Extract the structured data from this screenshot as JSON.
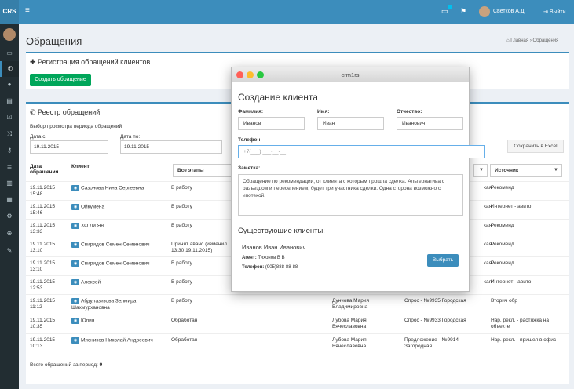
{
  "topbar": {
    "logo": "CRS",
    "menu_icon": "hamburger-icon",
    "user_name": "Светков А.Д.",
    "logout_label": "Выйти",
    "accent": "#3c8dbc"
  },
  "sidebar": {
    "icons": [
      "desktop-icon",
      "phone-icon",
      "user-icon",
      "document-icon",
      "check-icon",
      "shuffle-icon",
      "key-icon",
      "database-icon",
      "chart-icon",
      "calendar-icon",
      "tools-icon",
      "globe-icon",
      "edit-icon"
    ]
  },
  "page": {
    "title": "Обращения",
    "breadcrumb_home": "Главная",
    "breadcrumb_current": "Обращения"
  },
  "registration": {
    "title": "Регистрация обращений клиентов",
    "create_button": "Создать обращение"
  },
  "registry": {
    "title": "Реестр обращений",
    "period_label": "Выбор просмотра периода обращений",
    "date_from_label": "Дата с:",
    "date_from_value": "19.11.2015",
    "date_to_label": "Дата по:",
    "date_to_value": "19.11.2015",
    "export_button": "Сохранить в Excel",
    "columns": {
      "date": "Дата обращения",
      "client": "Клиент",
      "stages_select": "Все этапы",
      "source_select": "Источник"
    },
    "rows": [
      {
        "date": "19.11.2015",
        "time": "15:48",
        "client": "Сазонова Нина Сергеевна",
        "stage": "В работу",
        "agent": "",
        "offer": "кая",
        "source": "Рекоменд"
      },
      {
        "date": "19.11.2015",
        "time": "15:46",
        "client": "Ойкумена",
        "stage": "В работу",
        "agent": "",
        "offer": "кая",
        "source": "Интернет - авито"
      },
      {
        "date": "19.11.2015",
        "time": "13:33",
        "client": "ХО Ли Ян",
        "stage": "В работу",
        "agent": "",
        "offer": "кая",
        "source": "Рекоменд"
      },
      {
        "date": "19.11.2015",
        "time": "13:10",
        "client": "Свиридов Семен Семенович",
        "stage": "Принят аванс (изменил 13:30 19.11.2015)",
        "agent": "",
        "offer": "кая",
        "source": "Рекоменд"
      },
      {
        "date": "19.11.2015",
        "time": "13:10",
        "client": "Свиридов Семен Семенович",
        "stage": "В работу",
        "agent": "",
        "offer": "кая",
        "source": "Рекоменд"
      },
      {
        "date": "19.11.2015",
        "time": "12:53",
        "client": "Алексей",
        "stage": "В работу",
        "agent": "",
        "offer": "кая",
        "source": "Интернет - авито"
      },
      {
        "date": "19.11.2015",
        "time": "11:12",
        "client": "Абдулазизова Зелмира Шахмурхановна",
        "stage": "В работу",
        "agent": "Дунчова Мария Владимировна",
        "offer": "Спрос - №9935 Городская",
        "source": "Вторич обр"
      },
      {
        "date": "19.11.2015",
        "time": "10:35",
        "client": "Юлия",
        "stage": "Обработан",
        "agent": "Лубова Мария Вячеславовна",
        "offer": "Спрос - №9933 Городская",
        "source": "Нар. рекл. - растяжка на объекте"
      },
      {
        "date": "19.11.2015",
        "time": "10:13",
        "client": "Мясников Николай Андреевич",
        "stage": "Обработан",
        "agent": "Лубова Мария Вячеславовна",
        "offer": "Предложение - №9914 Загородная",
        "source": "Нар. рекл. - пришел в офис"
      }
    ],
    "total_label": "Всего обращений за период:",
    "total_value": "9"
  },
  "modal": {
    "window_title": "crm1rs",
    "heading": "Создание клиента",
    "surname_label": "Фамилия:",
    "surname_value": "Иванов",
    "name_label": "Имя:",
    "name_value": "Иван",
    "patronymic_label": "Отчество:",
    "patronymic_value": "Иванович",
    "phone_label": "Телефон:",
    "phone_value": "+7(___) ___-__-__",
    "note_label": "Заметка:",
    "note_value": "Обращение по рекомендации, от клиента с которым прошла сделка. Альтернатива с разъездом и переселением, будет три участника сделки. Одна сторона возможно с ипотекой.",
    "existing_heading": "Существующие клиенты:",
    "existing_client_name": "Иванов Иван Иванович",
    "existing_agent_label": "Агент:",
    "existing_agent_value": "Тихонов В В",
    "existing_phone_label": "Телефон:",
    "existing_phone_value": "(905)888-88-88",
    "select_button": "Выбрать"
  }
}
